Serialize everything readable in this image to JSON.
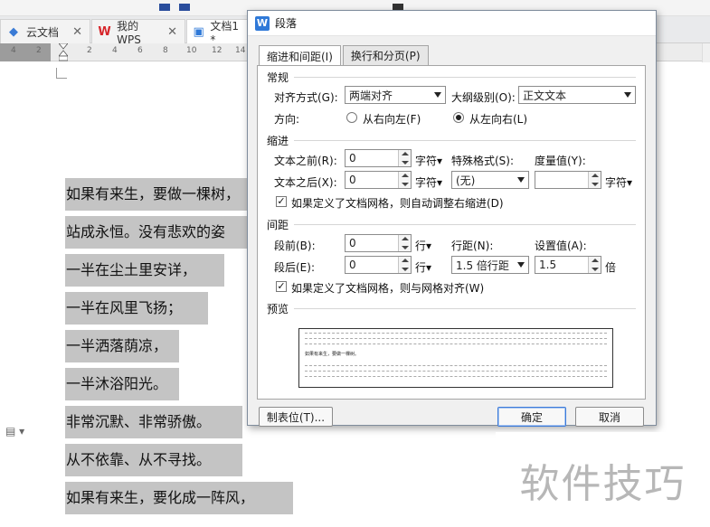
{
  "tabs": [
    {
      "label": "云文档",
      "icon": "cloud-doc-icon"
    },
    {
      "label": "我的WPS",
      "icon": "wps-logo-icon"
    },
    {
      "label": "文档1 *",
      "icon": "document-icon"
    }
  ],
  "ruler_numbers": [
    "4",
    "2",
    "2",
    "4",
    "6",
    "8",
    "10",
    "12",
    "14"
  ],
  "document": {
    "lines": [
      "如果有来生，要做一棵树，",
      "站成永恒。没有悲欢的姿",
      "一半在尘土里安详，",
      "一半在风里飞扬；",
      "一半洒落荫凉，",
      "一半沐浴阳光。",
      "非常沉默、非常骄傲。",
      "从不依靠、从不寻找。",
      "如果有来生，要化成一阵风，"
    ]
  },
  "dialog": {
    "title": "段落",
    "tabs": [
      "缩进和间距(I)",
      "换行和分页(P)"
    ],
    "general": {
      "section": "常规",
      "align_label": "对齐方式(G):",
      "align_value": "两端对齐",
      "outline_label": "大纲级别(O):",
      "outline_value": "正文文本",
      "direction_label": "方向:",
      "rtl_label": "从右向左(F)",
      "ltr_label": "从左向右(L)"
    },
    "indent": {
      "section": "缩进",
      "before_label": "文本之前(R):",
      "before_value": "0",
      "before_unit": "字符▾",
      "after_label": "文本之后(X):",
      "after_value": "0",
      "after_unit": "字符▾",
      "special_label": "特殊格式(S):",
      "special_value": "(无)",
      "measure_label": "度量值(Y):",
      "measure_value": "",
      "measure_unit": "字符▾",
      "grid_check_label": "如果定义了文档网格，则自动调整右缩进(D)"
    },
    "spacing": {
      "section": "间距",
      "before_label": "段前(B):",
      "before_value": "0",
      "before_unit": "行▾",
      "after_label": "段后(E):",
      "after_value": "0",
      "after_unit": "行▾",
      "line_label": "行距(N):",
      "line_value": "1.5 倍行距",
      "setting_label": "设置值(A):",
      "setting_value": "1.5",
      "setting_unit": "倍",
      "grid_check_label": "如果定义了文档网格，则与网格对齐(W)"
    },
    "preview": {
      "label": "预览",
      "sample_text": "如果有来生，要做一棵树。"
    },
    "buttons": {
      "tabs": "制表位(T)...",
      "ok": "确定",
      "cancel": "取消"
    }
  },
  "watermark": "软件技巧",
  "colors": {
    "selection": "#c4c4c4",
    "wps_blue": "#2f79d8",
    "wps_red": "#d7262b"
  }
}
